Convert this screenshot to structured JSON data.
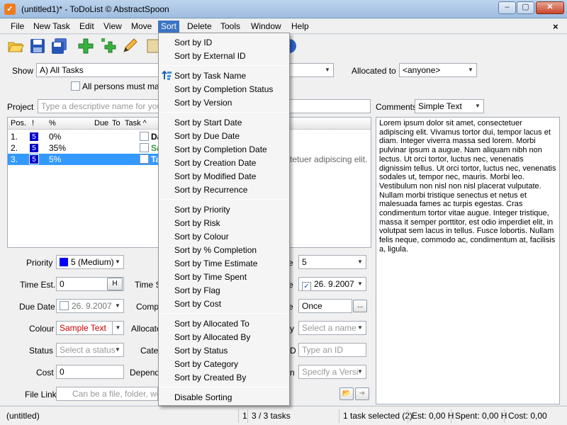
{
  "window": {
    "title": "(untitled1)* - ToDoList © AbstractSpoon",
    "app_icon": "checkmark-icon",
    "minimize_label": "–",
    "maximize_label": "▢",
    "close_label": "✕"
  },
  "menu": {
    "items": [
      "File",
      "New Task",
      "Edit",
      "View",
      "Move",
      "Sort",
      "Delete",
      "Tools",
      "Window",
      "Help"
    ],
    "active": "Sort",
    "mdi_close": "×"
  },
  "toolbar": {
    "icons": [
      "open-folder-icon",
      "save-icon",
      "save-all-icon",
      "add-task-icon",
      "add-subtask-icon",
      "edit-pencil-icon",
      "tool-icon",
      "help-icon"
    ]
  },
  "filter": {
    "show_label": "Show",
    "show_value": "A)  All Tasks",
    "allocated_label": "Allocated to",
    "allocated_value": "<anyone>",
    "all_persons_label": "All persons must match"
  },
  "project": {
    "label": "Project",
    "placeholder": "Type a descriptive name for your t",
    "comments_label": "Comments",
    "comments_type": "Simple Text"
  },
  "tasklist": {
    "headers": [
      "Pos.",
      "!",
      "%",
      "Due",
      "To",
      "Task ^"
    ],
    "rows": [
      {
        "pos": "1.",
        "priority": "5",
        "percent": "0%",
        "task": "Da",
        "selected": false
      },
      {
        "pos": "2.",
        "priority": "5",
        "percent": "35%",
        "task": "Sa",
        "selected": false
      },
      {
        "pos": "3.",
        "priority": "5",
        "percent": "5%",
        "task": "Ta",
        "selected": true
      }
    ],
    "overflow_text": "ctetuer adipiscing elit. V"
  },
  "comments_text": "Lorem ipsum dolor sit amet, consectetuer adipiscing elit. Vivamus tortor dui, tempor lacus et diam. Integer viverra massa sed lorem. Morbi pulvinar ipsum a augue. Nam aliquam nibh non lectus. Ut orci tortor, luctus nec, venenatis dignissim tellus. Ut orci tortor, luctus nec, venenatis sodales ut, tempor nec, mauris. Morbi leo. Vestibulum non nisl non nisl placerat vulputate. Nullam morbi tristique senectus et netus et malesuada fames ac turpis egestas. Cras condimentum tortor vitae augue. Integer tristique, massa it semper porttitor, est odio imperdiet elit, in volutpat sem lacus in tellus. Fusce lobortis. Nullam felis neque, commodo ac, condimentum at, facilisis a, ligula.",
  "fields": {
    "priority_label": "Priority",
    "priority_value": "5 (Medium)",
    "priority_color": "#0000ff",
    "time_est_label": "Time Est.",
    "time_est_value": "0",
    "time_est_unit": "H",
    "time_spent_label": "Time S",
    "due_date_label": "Due Date",
    "due_date_value": "26. 9.2007",
    "completion_label": "Compl",
    "colour_label": "Colour",
    "colour_value": "Sample Text",
    "allocated_label": "Allocate",
    "status_label": "Status",
    "status_placeholder": "Select a status",
    "category_label": "Cate",
    "cost_label": "Cost",
    "cost_value": "0",
    "depends_label": "Depend",
    "file_link_label": "File Link",
    "file_link_placeholder": "Can be a file, folder, web",
    "risk_value": "5",
    "start_date_value": "26. 9.2007",
    "recurrence_value": "Once",
    "recurrence_btn": "...",
    "allocated_by_placeholder": "Select a name",
    "external_id_placeholder": "Type an ID",
    "version_placeholder": "Specify a Versi",
    "right_label_1": "e",
    "right_label_2": "e",
    "right_label_3": "e",
    "right_label_4": "y",
    "right_label_5": "D",
    "right_label_6": "n"
  },
  "sort_menu": {
    "groups": [
      [
        "Sort by ID",
        "Sort by External ID"
      ],
      [
        "Sort by Task Name",
        "Sort by Completion Status",
        "Sort by Version"
      ],
      [
        "Sort by Start Date",
        "Sort by Due Date",
        "Sort by Completion Date",
        "Sort by Creation Date",
        "Sort by Modified Date",
        "Sort by Recurrence"
      ],
      [
        "Sort by Priority",
        "Sort by Risk",
        "Sort by Colour",
        "Sort by % Completion",
        "Sort by Time Estimate",
        "Sort by Time Spent",
        "Sort by Flag",
        "Sort by Cost"
      ],
      [
        "Sort by Allocated To",
        "Sort by Allocated By",
        "Sort by Status",
        "Sort by Category",
        "Sort by Created By"
      ],
      [
        "Disable Sorting"
      ]
    ],
    "checked_icon": "sort-ascending-icon"
  },
  "status": {
    "file": "(untitled)",
    "count": "1",
    "tasks": "3 / 3 tasks",
    "selected": "1 task selected (2)",
    "est": "Est: 0,00 H",
    "spent": "Spent: 0,00 H",
    "cost": "Cost: 0,00"
  }
}
